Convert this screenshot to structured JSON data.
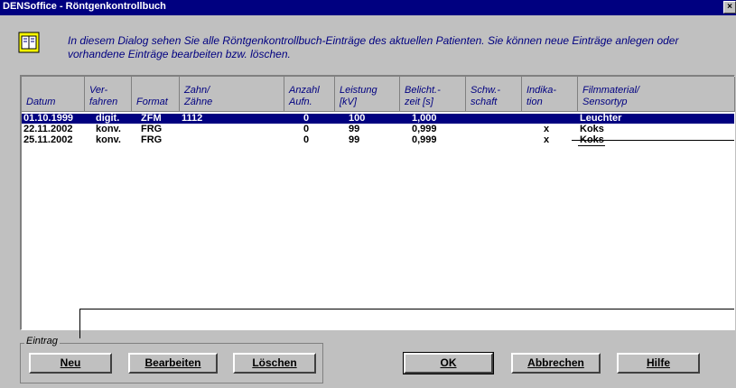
{
  "window": {
    "title": "DENSoffice - Röntgenkontrollbuch",
    "close": "×"
  },
  "info": {
    "text": "In diesem Dialog sehen Sie alle Röntgenkontrollbuch-Einträge des aktuellen Patienten. Sie können neue Einträge anlegen oder vorhandene Einträge bearbeiten bzw. löschen."
  },
  "table": {
    "headers": [
      "Datum",
      "Ver-\nfahren",
      "Format",
      "Zahn/\nZähne",
      "Anzahl\nAufn.",
      "Leistung\n[kV]",
      "Belicht.-\nzeit [s]",
      "Schw.-\nschaft",
      "Indika-\ntion",
      "Filmmaterial/\nSensortyp"
    ],
    "rows": [
      {
        "datum": "01.10.1999",
        "verfahren": "digit.",
        "format": "ZFM",
        "zahn": "1112",
        "anzahl": "0",
        "leistung": "100",
        "belicht": "1,000",
        "schw": "",
        "indikation": "",
        "film": "Leuchter",
        "selected": true
      },
      {
        "datum": "22.11.2002",
        "verfahren": "konv.",
        "format": "FRG",
        "zahn": "",
        "anzahl": "0",
        "leistung": "99",
        "belicht": "0,999",
        "schw": "",
        "indikation": "x",
        "film": "Koks",
        "selected": false
      },
      {
        "datum": "25.11.2002",
        "verfahren": "konv.",
        "format": "FRG",
        "zahn": "",
        "anzahl": "0",
        "leistung": "99",
        "belicht": "0,999",
        "schw": "",
        "indikation": "x",
        "film": "Koks",
        "selected": false
      }
    ]
  },
  "eintrag": {
    "label": "Eintrag",
    "buttons": {
      "neu": "Neu",
      "bearbeiten": "Bearbeiten",
      "loeschen": "Löschen"
    }
  },
  "actions": {
    "ok": "OK",
    "abbrechen": "Abbrechen",
    "hilfe": "Hilfe"
  },
  "icons": {
    "info": "book-icon",
    "close": "close-icon"
  }
}
